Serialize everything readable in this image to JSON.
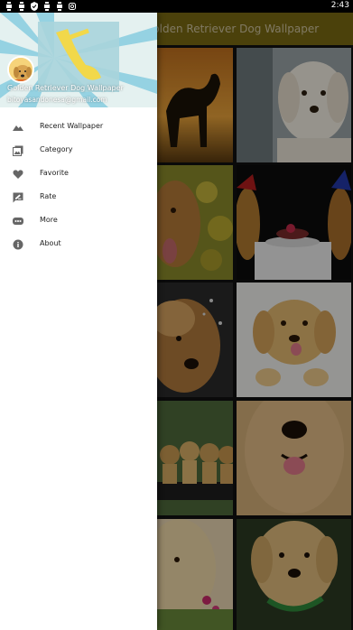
{
  "status_bar": {
    "time": "2:43",
    "icons": [
      "notification-icon",
      "notification-icon",
      "shield-icon",
      "notification-icon",
      "notification-icon",
      "instagram-icon"
    ]
  },
  "app_bar": {
    "title": "Golden Retriever Dog Wallpaper",
    "color": "#7a6a12"
  },
  "drawer": {
    "header": {
      "app_title": "Golden Retriever Dog Wallpaper",
      "email": "bitoyasandonesa@gmail.com"
    },
    "items": [
      {
        "label": "Recent Wallpaper",
        "icon": "landscape-icon"
      },
      {
        "label": "Category",
        "icon": "photo-library-icon"
      },
      {
        "label": "Favorite",
        "icon": "heart-icon"
      },
      {
        "label": "Rate",
        "icon": "rate-review-icon"
      },
      {
        "label": "More",
        "icon": "more-icon"
      },
      {
        "label": "About",
        "icon": "info-icon"
      }
    ]
  },
  "grid": {
    "tiles": [
      {
        "description": "dog-silhouette-sunset"
      },
      {
        "description": "white-golden-retriever"
      },
      {
        "description": "golden-retriever-flowers"
      },
      {
        "description": "dogs-party-cake"
      },
      {
        "description": "golden-retriever-snow"
      },
      {
        "description": "puppy-white-background"
      },
      {
        "description": "puppies-on-bench"
      },
      {
        "description": "golden-retriever-closeup"
      },
      {
        "description": "puppy-with-flowers"
      },
      {
        "description": "labrador-green-collar"
      }
    ]
  }
}
